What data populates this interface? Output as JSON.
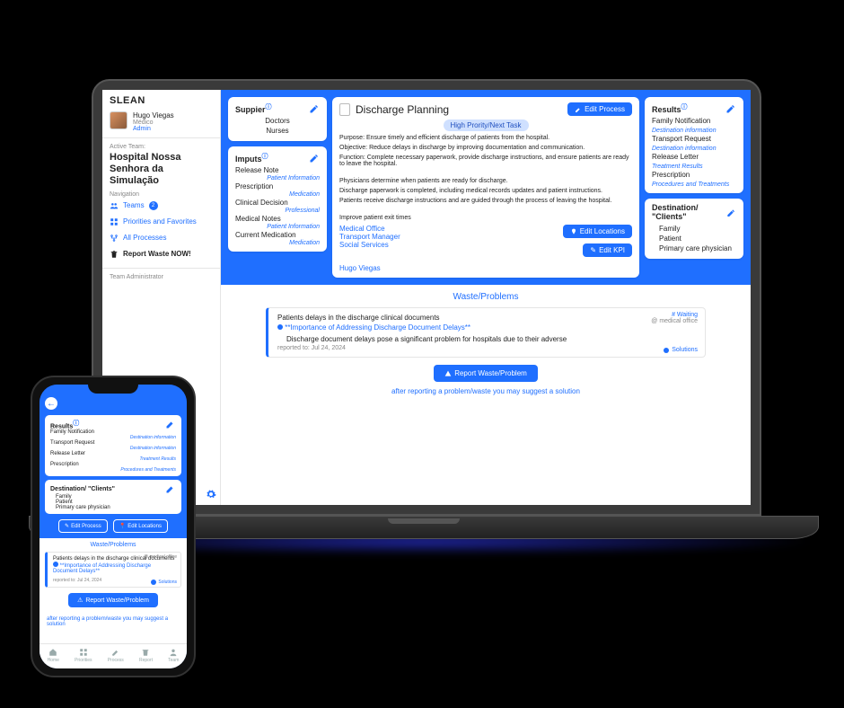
{
  "app": {
    "title": "SLEAN"
  },
  "user": {
    "name": "Hugo Viegas",
    "role": "Médico",
    "perm": "Admin"
  },
  "team": {
    "label": "Active Team:",
    "name": "Hospital Nossa Senhora da Simulação",
    "navLabel": "Navigation"
  },
  "nav": {
    "teams": "Teams",
    "teamsCount": "2",
    "priorities": "Priorities and Favorites",
    "processes": "All Processes",
    "report": "Report Waste NOW!",
    "adminLabel": "Team Administrator"
  },
  "supplier": {
    "title": "Suppier",
    "items": [
      "Doctors",
      "Nurses"
    ]
  },
  "inputs": {
    "title": "Imputs",
    "rows": [
      {
        "label": "Release Note",
        "note": "Patient Information"
      },
      {
        "label": "Prescription",
        "note": "Medication"
      },
      {
        "label": "Clinical Decision",
        "note": "Professional"
      },
      {
        "label": "Medical Notes",
        "note": "Patient Information"
      },
      {
        "label": "Current Medication",
        "note": "Medication"
      }
    ]
  },
  "process": {
    "title": "Discharge Planning",
    "editProcess": "Edit Process",
    "priority": "High Prority/Next Task",
    "purpose": "Purpose: Ensure timely and efficient discharge of patients from the hospital.",
    "objective": "Objective: Reduce delays in discharge by improving documentation and communication.",
    "function": "Function: Complete necessary paperwork, provide discharge instructions, and ensure patients are ready to leave the hospital.",
    "body1": "Physicians determine when patients are ready for discharge.",
    "body2": "Discharge paperwork is completed, including medical records updates and patient instructions.",
    "body3": "Patients receive discharge instructions and are guided through the process of leaving the hospital.",
    "kpi": "Improve patient exit times",
    "locations": [
      "Medical Office",
      "Transport Manager",
      "Social Services"
    ],
    "editLocations": "Edit Locations",
    "editKpi": "Edit KPI",
    "owner": "Hugo Viegas"
  },
  "results": {
    "title": "Results",
    "rows": [
      {
        "label": "Family Notification",
        "note": "Destination information"
      },
      {
        "label": "Transport Request",
        "note": "Destination information"
      },
      {
        "label": "Release Letter",
        "note": "Treatment Results"
      },
      {
        "label": "Prescription",
        "note": "Procedures and Treatments"
      }
    ]
  },
  "destination": {
    "title": "Destination/ \"Clients\"",
    "items": [
      "Family",
      "Patient",
      "Primary care physician"
    ]
  },
  "waste": {
    "heading": "Waste/Problems",
    "item": {
      "title": "Patients delays in the discharge clinical documents",
      "sub": "**Importance of Addressing Discharge Document Delays**",
      "desc": "Discharge document delays pose a significant problem for hospitals due to their adverse",
      "reported": "reported to: Jul 24, 2024",
      "status": "# Waiting",
      "where": "@ medical office",
      "solutions": "Solutions"
    },
    "reportBtn": "Report Waste/Problem",
    "note": "after reporting a problem/waste you may suggest a solution"
  },
  "step": "2",
  "phone": {
    "btnProcess": "Edit Process",
    "btnLocations": "Edit Locations",
    "tabbar": [
      "Home",
      "Priorities",
      "Process",
      "Report",
      "Team"
    ]
  }
}
